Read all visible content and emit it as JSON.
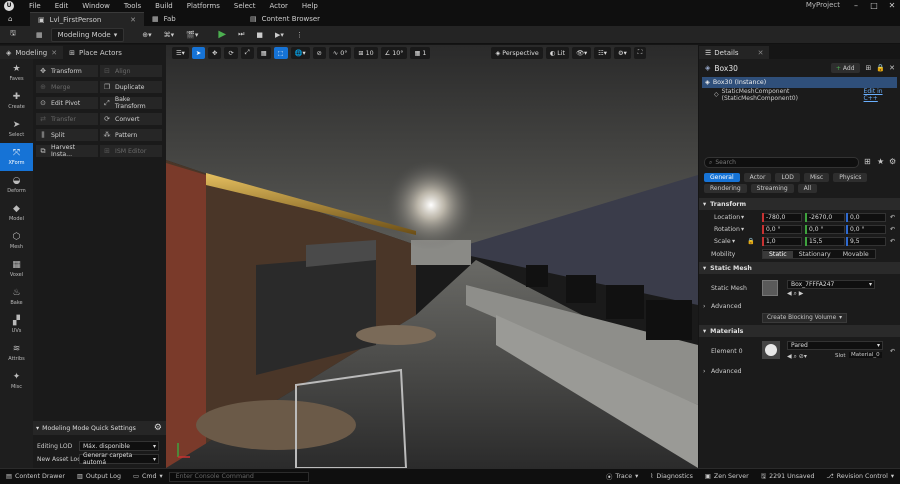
{
  "menubar": {
    "items": [
      "File",
      "Edit",
      "Window",
      "Tools",
      "Build",
      "Platforms",
      "Select",
      "Actor",
      "Help"
    ],
    "project": "MyProject"
  },
  "tabs": {
    "level": "Lvl_FirstPerson",
    "fab": "Fab",
    "browser": "Content Browser"
  },
  "toolbar": {
    "mode": "Modeling Mode"
  },
  "left_panel": {
    "tabs": [
      "Modeling",
      "Place Actors"
    ],
    "rail": [
      "Faves",
      "Create",
      "Select",
      "XForm",
      "Deform",
      "Model",
      "Mesh",
      "Voxel",
      "Bake",
      "UVs",
      "Attribs",
      "Misc"
    ],
    "tools": [
      {
        "label": "Transform",
        "enabled": true
      },
      {
        "label": "Align",
        "enabled": false
      },
      {
        "label": "Merge",
        "enabled": false
      },
      {
        "label": "Duplicate",
        "enabled": true
      },
      {
        "label": "Edit Pivot",
        "enabled": true
      },
      {
        "label": "Bake Transform",
        "enabled": true
      },
      {
        "label": "Transfer",
        "enabled": false
      },
      {
        "label": "Convert",
        "enabled": true
      },
      {
        "label": "Split",
        "enabled": true
      },
      {
        "label": "Pattern",
        "enabled": true
      },
      {
        "label": "Harvest Insta...",
        "enabled": true
      },
      {
        "label": "ISM Editor",
        "enabled": false
      }
    ],
    "quick_settings": {
      "title": "Modeling Mode Quick Settings",
      "lod_label": "Editing LOD",
      "lod_value": "Máx. disponible",
      "asset_label": "New Asset Loc",
      "asset_value": "Generar carpeta automá"
    }
  },
  "viewport": {
    "perspective": "Perspective",
    "lit": "Lit",
    "angle": "10°",
    "grid": "10",
    "scale": "0°"
  },
  "details": {
    "tab": "Details",
    "actor": "Box30",
    "add_label": "Add",
    "instance": "Box30 (Instance)",
    "component": "StaticMeshComponent (StaticMeshComponent0)",
    "edit_cpp": "Edit in C++",
    "search_placeholder": "Search",
    "filters_row1": [
      "General",
      "Actor",
      "LOD",
      "Misc",
      "Physics"
    ],
    "filters_row2": [
      "Rendering",
      "Streaming",
      "All"
    ],
    "transform": {
      "section": "Transform",
      "location": {
        "label": "Location",
        "x": "-780,0",
        "y": "-2670,0",
        "z": "0,0"
      },
      "rotation": {
        "label": "Rotation",
        "x": "0,0 °",
        "y": "0,0 °",
        "z": "0,0 °"
      },
      "scale": {
        "label": "Scale",
        "x": "1,0",
        "y": "15,5",
        "z": "9,5"
      },
      "mobility_label": "Mobility",
      "mobility": [
        "Static",
        "Stationary",
        "Movable"
      ]
    },
    "static_mesh": {
      "section": "Static Mesh",
      "label": "Static Mesh",
      "value": "Box_7FFFA247",
      "advanced": "Advanced",
      "collision_btn": "Create Blocking Volume"
    },
    "materials": {
      "section": "Materials",
      "element": "Element 0",
      "value": "Pared",
      "slot_label": "Slot",
      "slot": "Material_0",
      "advanced": "Advanced"
    }
  },
  "statusbar": {
    "drawer": "Content Drawer",
    "output": "Output Log",
    "cmd": "Cmd",
    "console_placeholder": "Enter Console Command",
    "trace": "Trace",
    "diagnostics": "Diagnostics",
    "zen": "Zen Server",
    "unsaved": "2291 Unsaved",
    "revision": "Revision Control"
  },
  "colors": {
    "accent": "#1673d6",
    "play": "#4caf50",
    "x_axis": "#c83232",
    "y_axis": "#3ea33e",
    "z_axis": "#2f6ad0"
  }
}
